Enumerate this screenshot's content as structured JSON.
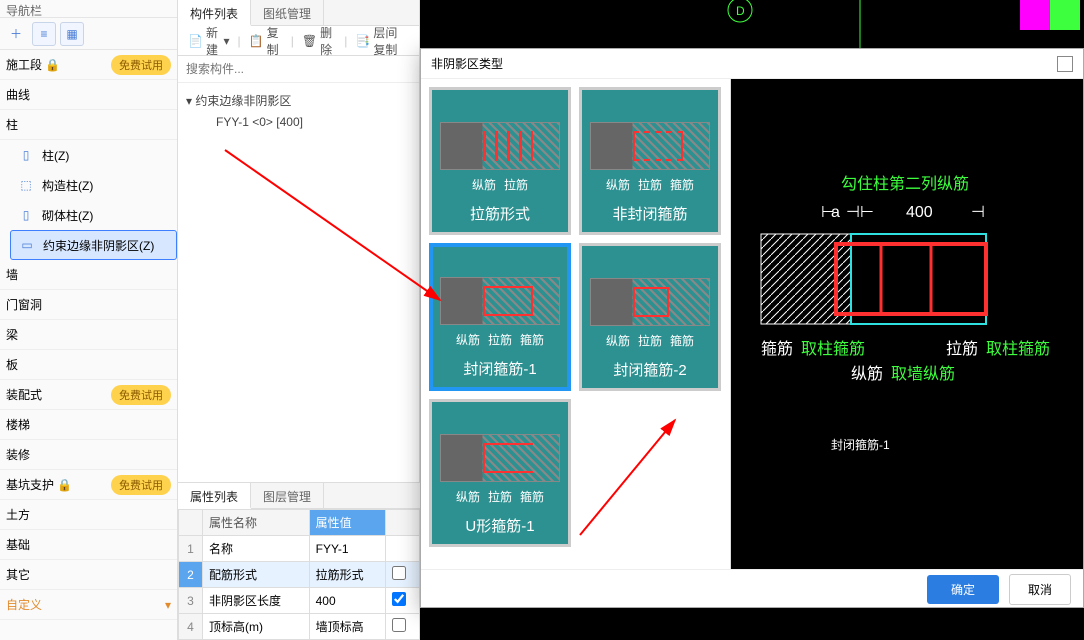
{
  "nav": {
    "title": "导航栏",
    "badge_try": "免费试用",
    "items": {
      "construction": "施工段",
      "axis": "曲线",
      "column": "柱",
      "col_z": "柱(Z)",
      "col_gz": "构造柱(Z)",
      "col_qt": "砌体柱(Z)",
      "col_ys": "约束边缘非阴影区(Z)",
      "wall": "墙",
      "door": "门窗洞",
      "beam": "梁",
      "slab": "板",
      "assembly": "装配式",
      "stair": "楼梯",
      "deco": "装修",
      "pit": "基坑支护",
      "earth": "土方",
      "found": "基础",
      "other": "其它",
      "custom": "自定义"
    }
  },
  "mid": {
    "tabs": {
      "list": "构件列表",
      "draw": "图纸管理"
    },
    "toolbar": {
      "new": "新建",
      "copy": "复制",
      "del": "删除",
      "layer": "层间复制"
    },
    "search_ph": "搜索构件...",
    "tree": {
      "root": "约束边缘非阴影区",
      "leaf": "FYY-1 <0> [400]"
    }
  },
  "prop": {
    "tabs": {
      "attr": "属性列表",
      "layer": "图层管理"
    },
    "headers": {
      "name": "属性名称",
      "val": "属性值"
    },
    "rows": [
      {
        "idx": "1",
        "name": "名称",
        "val": "FYY-1",
        "ck": false
      },
      {
        "idx": "2",
        "name": "配筋形式",
        "val": "拉筋形式",
        "ck": false
      },
      {
        "idx": "3",
        "name": "非阴影区长度",
        "val": "400",
        "ck": true
      },
      {
        "idx": "4",
        "name": "顶标高(m)",
        "val": "墙顶标高",
        "ck": false
      }
    ]
  },
  "dialog": {
    "title": "非阴影区类型",
    "cards": [
      {
        "label": "拉筋形式",
        "subs": [
          "纵筋",
          "拉筋"
        ]
      },
      {
        "label": "非封闭箍筋",
        "subs": [
          "纵筋",
          "拉筋",
          "箍筋"
        ]
      },
      {
        "label": "封闭箍筋-1",
        "subs": [
          "纵筋",
          "拉筋",
          "箍筋"
        ]
      },
      {
        "label": "封闭箍筋-2",
        "subs": [
          "纵筋",
          "拉筋",
          "箍筋"
        ]
      },
      {
        "label": "U形箍筋-1",
        "subs": [
          "纵筋",
          "拉筋",
          "箍筋"
        ]
      }
    ],
    "ok": "确定",
    "cancel": "取消"
  },
  "preview": {
    "title": "封闭箍筋-1",
    "top": "勾住柱第二列纵筋",
    "dim_a": "a",
    "dim_400": "400",
    "lbl_gj": "箍筋",
    "lbl_gj_v": "取柱箍筋",
    "lbl_lj": "拉筋",
    "lbl_lj_v": "取柱箍筋",
    "lbl_zj": "纵筋",
    "lbl_zj_v": "取墙纵筋"
  }
}
